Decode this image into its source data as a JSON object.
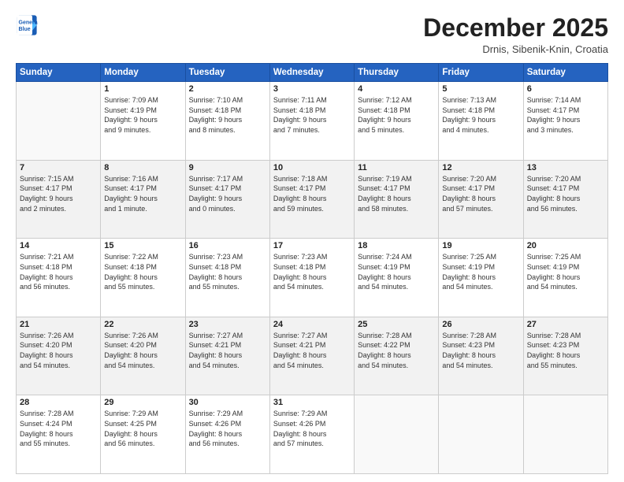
{
  "header": {
    "logo_line1": "General",
    "logo_line2": "Blue",
    "month_title": "December 2025",
    "location": "Drnis, Sibenik-Knin, Croatia"
  },
  "weekdays": [
    "Sunday",
    "Monday",
    "Tuesday",
    "Wednesday",
    "Thursday",
    "Friday",
    "Saturday"
  ],
  "weeks": [
    [
      {
        "day": "",
        "info": ""
      },
      {
        "day": "1",
        "info": "Sunrise: 7:09 AM\nSunset: 4:19 PM\nDaylight: 9 hours\nand 9 minutes."
      },
      {
        "day": "2",
        "info": "Sunrise: 7:10 AM\nSunset: 4:18 PM\nDaylight: 9 hours\nand 8 minutes."
      },
      {
        "day": "3",
        "info": "Sunrise: 7:11 AM\nSunset: 4:18 PM\nDaylight: 9 hours\nand 7 minutes."
      },
      {
        "day": "4",
        "info": "Sunrise: 7:12 AM\nSunset: 4:18 PM\nDaylight: 9 hours\nand 5 minutes."
      },
      {
        "day": "5",
        "info": "Sunrise: 7:13 AM\nSunset: 4:18 PM\nDaylight: 9 hours\nand 4 minutes."
      },
      {
        "day": "6",
        "info": "Sunrise: 7:14 AM\nSunset: 4:17 PM\nDaylight: 9 hours\nand 3 minutes."
      }
    ],
    [
      {
        "day": "7",
        "info": "Sunrise: 7:15 AM\nSunset: 4:17 PM\nDaylight: 9 hours\nand 2 minutes."
      },
      {
        "day": "8",
        "info": "Sunrise: 7:16 AM\nSunset: 4:17 PM\nDaylight: 9 hours\nand 1 minute."
      },
      {
        "day": "9",
        "info": "Sunrise: 7:17 AM\nSunset: 4:17 PM\nDaylight: 9 hours\nand 0 minutes."
      },
      {
        "day": "10",
        "info": "Sunrise: 7:18 AM\nSunset: 4:17 PM\nDaylight: 8 hours\nand 59 minutes."
      },
      {
        "day": "11",
        "info": "Sunrise: 7:19 AM\nSunset: 4:17 PM\nDaylight: 8 hours\nand 58 minutes."
      },
      {
        "day": "12",
        "info": "Sunrise: 7:20 AM\nSunset: 4:17 PM\nDaylight: 8 hours\nand 57 minutes."
      },
      {
        "day": "13",
        "info": "Sunrise: 7:20 AM\nSunset: 4:17 PM\nDaylight: 8 hours\nand 56 minutes."
      }
    ],
    [
      {
        "day": "14",
        "info": "Sunrise: 7:21 AM\nSunset: 4:18 PM\nDaylight: 8 hours\nand 56 minutes."
      },
      {
        "day": "15",
        "info": "Sunrise: 7:22 AM\nSunset: 4:18 PM\nDaylight: 8 hours\nand 55 minutes."
      },
      {
        "day": "16",
        "info": "Sunrise: 7:23 AM\nSunset: 4:18 PM\nDaylight: 8 hours\nand 55 minutes."
      },
      {
        "day": "17",
        "info": "Sunrise: 7:23 AM\nSunset: 4:18 PM\nDaylight: 8 hours\nand 54 minutes."
      },
      {
        "day": "18",
        "info": "Sunrise: 7:24 AM\nSunset: 4:19 PM\nDaylight: 8 hours\nand 54 minutes."
      },
      {
        "day": "19",
        "info": "Sunrise: 7:25 AM\nSunset: 4:19 PM\nDaylight: 8 hours\nand 54 minutes."
      },
      {
        "day": "20",
        "info": "Sunrise: 7:25 AM\nSunset: 4:19 PM\nDaylight: 8 hours\nand 54 minutes."
      }
    ],
    [
      {
        "day": "21",
        "info": "Sunrise: 7:26 AM\nSunset: 4:20 PM\nDaylight: 8 hours\nand 54 minutes."
      },
      {
        "day": "22",
        "info": "Sunrise: 7:26 AM\nSunset: 4:20 PM\nDaylight: 8 hours\nand 54 minutes."
      },
      {
        "day": "23",
        "info": "Sunrise: 7:27 AM\nSunset: 4:21 PM\nDaylight: 8 hours\nand 54 minutes."
      },
      {
        "day": "24",
        "info": "Sunrise: 7:27 AM\nSunset: 4:21 PM\nDaylight: 8 hours\nand 54 minutes."
      },
      {
        "day": "25",
        "info": "Sunrise: 7:28 AM\nSunset: 4:22 PM\nDaylight: 8 hours\nand 54 minutes."
      },
      {
        "day": "26",
        "info": "Sunrise: 7:28 AM\nSunset: 4:23 PM\nDaylight: 8 hours\nand 54 minutes."
      },
      {
        "day": "27",
        "info": "Sunrise: 7:28 AM\nSunset: 4:23 PM\nDaylight: 8 hours\nand 55 minutes."
      }
    ],
    [
      {
        "day": "28",
        "info": "Sunrise: 7:28 AM\nSunset: 4:24 PM\nDaylight: 8 hours\nand 55 minutes."
      },
      {
        "day": "29",
        "info": "Sunrise: 7:29 AM\nSunset: 4:25 PM\nDaylight: 8 hours\nand 56 minutes."
      },
      {
        "day": "30",
        "info": "Sunrise: 7:29 AM\nSunset: 4:26 PM\nDaylight: 8 hours\nand 56 minutes."
      },
      {
        "day": "31",
        "info": "Sunrise: 7:29 AM\nSunset: 4:26 PM\nDaylight: 8 hours\nand 57 minutes."
      },
      {
        "day": "",
        "info": ""
      },
      {
        "day": "",
        "info": ""
      },
      {
        "day": "",
        "info": ""
      }
    ]
  ]
}
